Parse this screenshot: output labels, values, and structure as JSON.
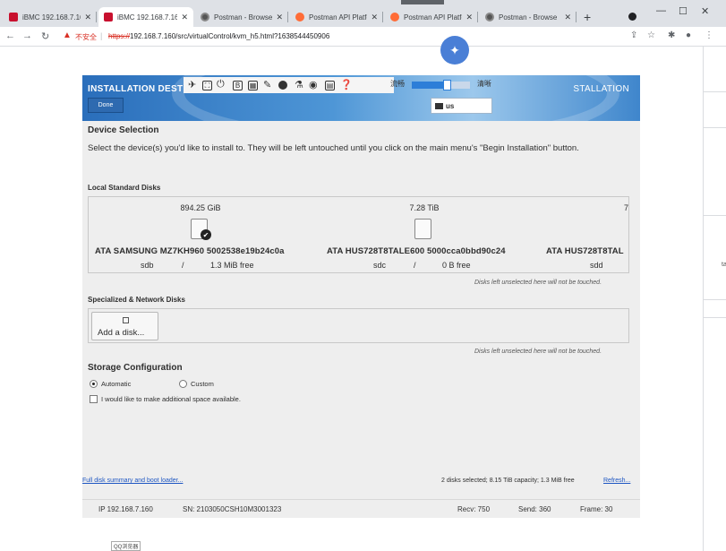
{
  "browser": {
    "tabs": [
      {
        "title": "iBMC 192.168.7.16",
        "icon": "ibmc-icon",
        "active": false
      },
      {
        "title": "iBMC 192.168.7.16",
        "icon": "ibmc-icon",
        "active": true
      },
      {
        "title": "Postman - Browse",
        "icon": "postman-icon",
        "active": false
      },
      {
        "title": "Postman API Platfo",
        "icon": "postman-api-icon",
        "active": false
      },
      {
        "title": "Postman API Platfo",
        "icon": "postman-api-icon",
        "active": false
      },
      {
        "title": "Postman - Browse",
        "icon": "postman-icon",
        "active": false
      }
    ],
    "new_tab": "+",
    "insecure_label": "不安全",
    "url_scheme": "https://",
    "url_rest": "192.168.7.160/src/virtualControl/kvm_h5.html?1638544450906"
  },
  "kvm": {
    "toolbar": {
      "smooth_label": "流畅",
      "clear_label": "清晰",
      "quality_fraction": 0.62
    },
    "installer": {
      "header_title": "INSTALLATION DEST",
      "header_right": "STALLATION",
      "done_label": "Done",
      "keyboard": "us",
      "device_selection_title": "Device Selection",
      "device_selection_desc": "Select the device(s) you'd like to install to.  They will be left untouched until you click on the main menu's \"Begin Installation\" button.",
      "local_disks_title": "Local Standard Disks",
      "disks": [
        {
          "size": "894.25 GiB",
          "model": "ATA SAMSUNG MZ7KH960 5002538e19b24c0a",
          "dev": "sdb",
          "slash": "/",
          "free": "1.3 MiB free",
          "selected": true
        },
        {
          "size": "7.28 TiB",
          "model": "ATA HUS728T8TALE600 5000cca0bbd90c24",
          "dev": "sdc",
          "slash": "/",
          "free": "0 B free",
          "selected": false
        },
        {
          "size": "7",
          "model": "ATA HUS728T8TAL",
          "dev": "sdd",
          "slash": "",
          "free": "",
          "selected": false
        }
      ],
      "untouched_note": "Disks left unselected here will not be touched.",
      "specialized_title": "Specialized & Network Disks",
      "add_disk_label": "Add a disk...",
      "storage_config_title": "Storage Configuration",
      "automatic_label": "Automatic",
      "custom_label": "Custom",
      "extra_space_label": "I would like to make additional space available.",
      "summary_link": "Full disk summary and boot loader...",
      "summary_text": "2 disks selected; 8.15 TiB capacity; 1.3 MiB free",
      "refresh_link": "Refresh..."
    },
    "status": {
      "ip": "IP 192.168.7.160",
      "sn": "SN: 2103050CSH10M3001323",
      "recv": "Recv: 750",
      "send": "Send: 360",
      "frame": "Frame: 30"
    }
  },
  "footer_tag": "QQ浏览器"
}
